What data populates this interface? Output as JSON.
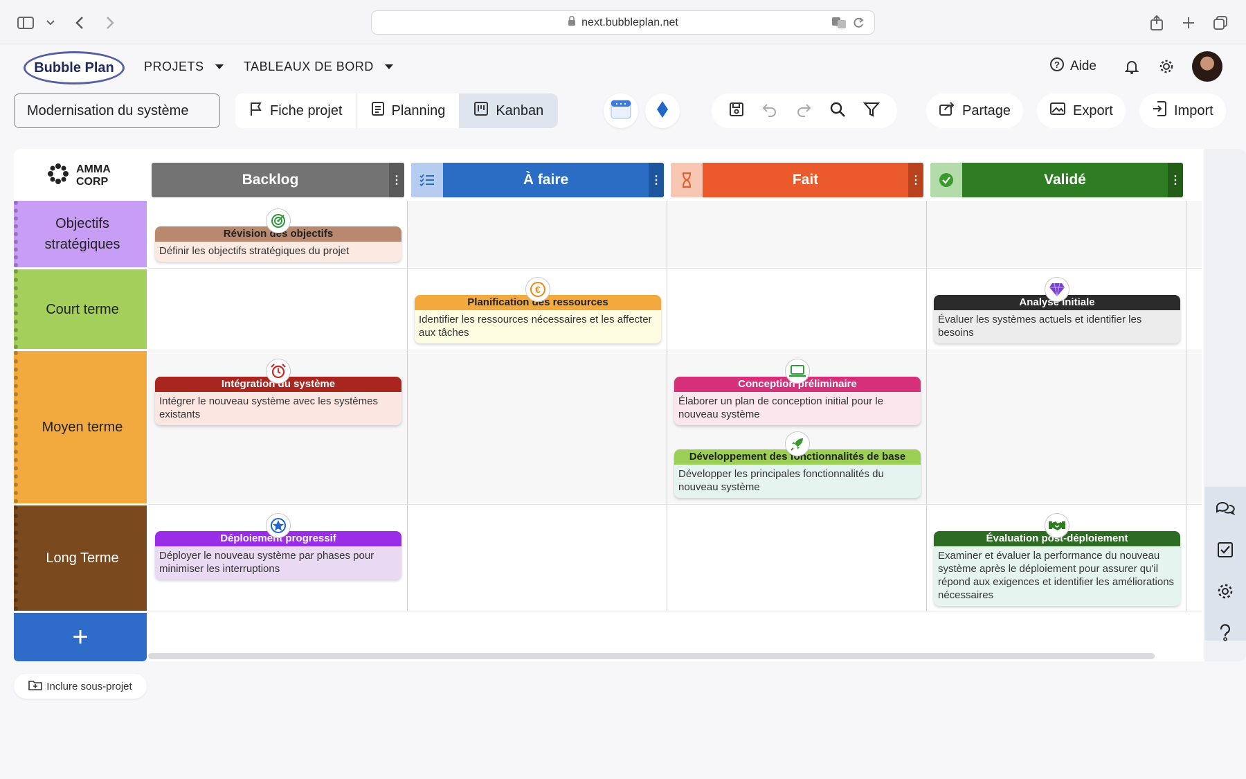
{
  "browser": {
    "url": "next.bubbleplan.net"
  },
  "header": {
    "logo_text": "Bubble Plan",
    "menu_projects": "PROJETS",
    "menu_dashboards": "TABLEAUX DE BORD",
    "help_label": "Aide"
  },
  "toolbar": {
    "project_name": "Modernisation du système",
    "tabs": [
      {
        "label": "Fiche projet"
      },
      {
        "label": "Planning"
      },
      {
        "label": "Kanban"
      }
    ],
    "share_label": "Partage",
    "export_label": "Export",
    "import_label": "Import"
  },
  "board": {
    "company_line1": "AMMA",
    "company_line2": "CORP",
    "columns": [
      {
        "title": "Backlog",
        "color": "#737373",
        "icon": "none"
      },
      {
        "title": "À faire",
        "color": "#2b6cc4",
        "icon": "checklist-icon"
      },
      {
        "title": "Fait",
        "color": "#ea5a2b",
        "icon": "hourglass-icon"
      },
      {
        "title": "Validé",
        "color": "#2e7d22",
        "icon": "check-circle-icon"
      }
    ],
    "rows": [
      {
        "label": "Objectifs stratégiques",
        "color": "#c79df5"
      },
      {
        "label": "Court terme",
        "color": "#a3cf5a"
      },
      {
        "label": "Moyen terme",
        "color": "#f2a93d"
      },
      {
        "label": "Long Terme",
        "color": "#7a4a1e"
      }
    ],
    "cards": [
      {
        "title": "Révision des objectifs",
        "desc": "Définir les objectifs stratégiques du projet",
        "icon": "target-icon"
      },
      {
        "title": "Planification des ressources",
        "desc": "Identifier les ressources nécessaires et les affecter aux tâches",
        "icon": "euro-icon"
      },
      {
        "title": "Analyse Initiale",
        "desc": "Évaluer les systèmes actuels et identifier les besoins",
        "icon": "diamond-icon"
      },
      {
        "title": "Intégration du système",
        "desc": "Intégrer le nouveau système avec les systèmes existants",
        "icon": "alarm-icon"
      },
      {
        "title": "Conception préliminaire",
        "desc": "Élaborer un plan de conception initial pour le nouveau système",
        "icon": "laptop-icon"
      },
      {
        "title": "Développement des fonctionnalités de base",
        "desc": "Développer les principales fonctionnalités du nouveau système",
        "icon": "rocket-icon"
      },
      {
        "title": "Déploiement progressif",
        "desc": "Déployer le nouveau système par phases pour minimiser les interruptions",
        "icon": "star-icon"
      },
      {
        "title": "Évaluation post-déploiement",
        "desc": "Examiner et évaluer la performance du nouveau système après le déploiement pour assurer qu'il répond aux exigences et identifier les améliorations nécessaires",
        "icon": "handshake-icon"
      }
    ],
    "add_row_label": "+"
  },
  "footer": {
    "include_label": "Inclure sous-projet"
  }
}
